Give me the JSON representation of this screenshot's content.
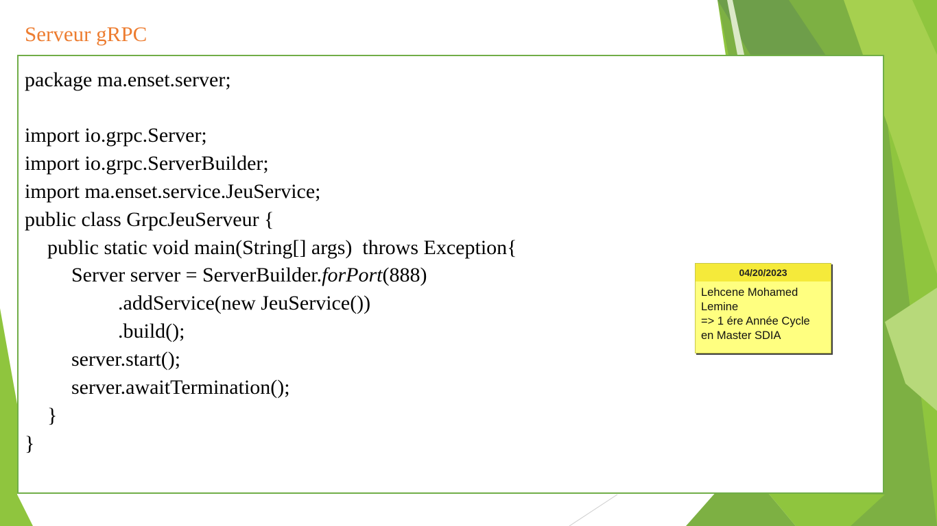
{
  "slide": {
    "title": "Serveur gRPC",
    "code_lines": [
      "package ma.enset.server;",
      "import io.grpc.Server;",
      "import io.grpc.ServerBuilder;",
      "import ma.enset.service.JeuService;",
      "public class GrpcJeuServeur {",
      "public static void main(String[] args)  throws Exception{",
      "Server server = ServerBuilder.",
      "forPort",
      "(888)",
      ".addService(new JeuService())",
      ".build();",
      "server.start();",
      "server.awaitTermination();",
      "}",
      "}"
    ]
  },
  "note": {
    "date": "04/20/2023",
    "lines": [
      "Lehcene Mohamed",
      "Lemine",
      "=> 1 ére Année Cycle",
      "en Master SDIA"
    ]
  },
  "colors": {
    "title": "#ed7d31",
    "accent_green": "#70ad47",
    "note_background": "#ffff80",
    "note_header": "#f5ea3a"
  }
}
